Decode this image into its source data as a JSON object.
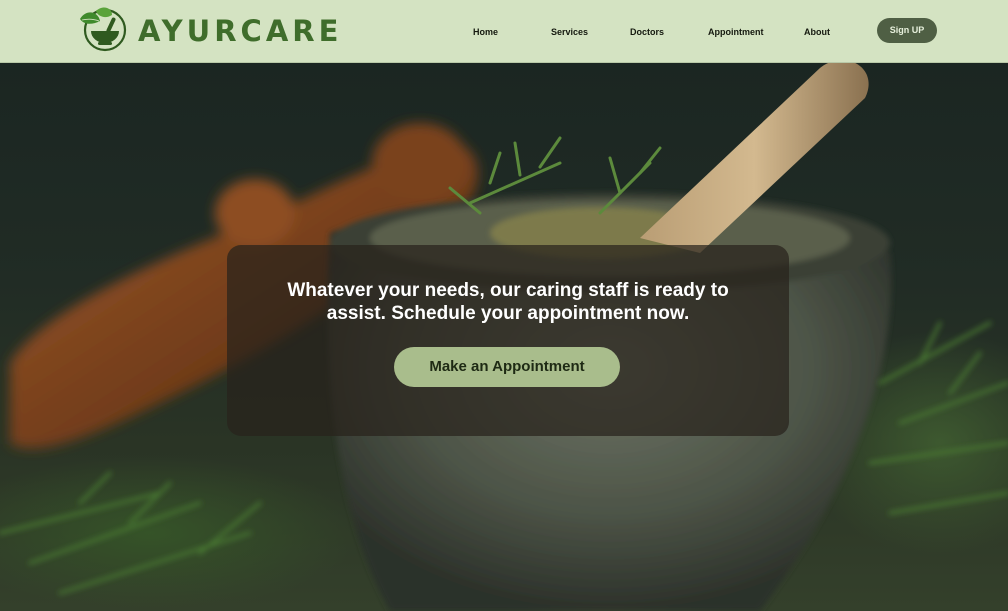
{
  "brand": {
    "name": "AyurCare",
    "logo_text": "AYURCARE",
    "logo_icon": "mortar-leaf-icon",
    "accent_color": "#3f6d2b"
  },
  "nav": {
    "items": [
      {
        "label": "Home"
      },
      {
        "label": "Services"
      },
      {
        "label": "Doctors"
      },
      {
        "label": "Appointment"
      },
      {
        "label": "About"
      }
    ],
    "signup_label": "Sign UP"
  },
  "hero": {
    "background_image": "herbs-mortar-pestle-photo",
    "message": "Whatever your needs, our caring staff is ready to assist. Schedule your appointment now.",
    "cta_label": "Make an Appointment"
  },
  "colors": {
    "header_bg": "#d4e3c2",
    "signup_bg": "#4f5f44",
    "cta_bg": "#a9bd8c"
  }
}
